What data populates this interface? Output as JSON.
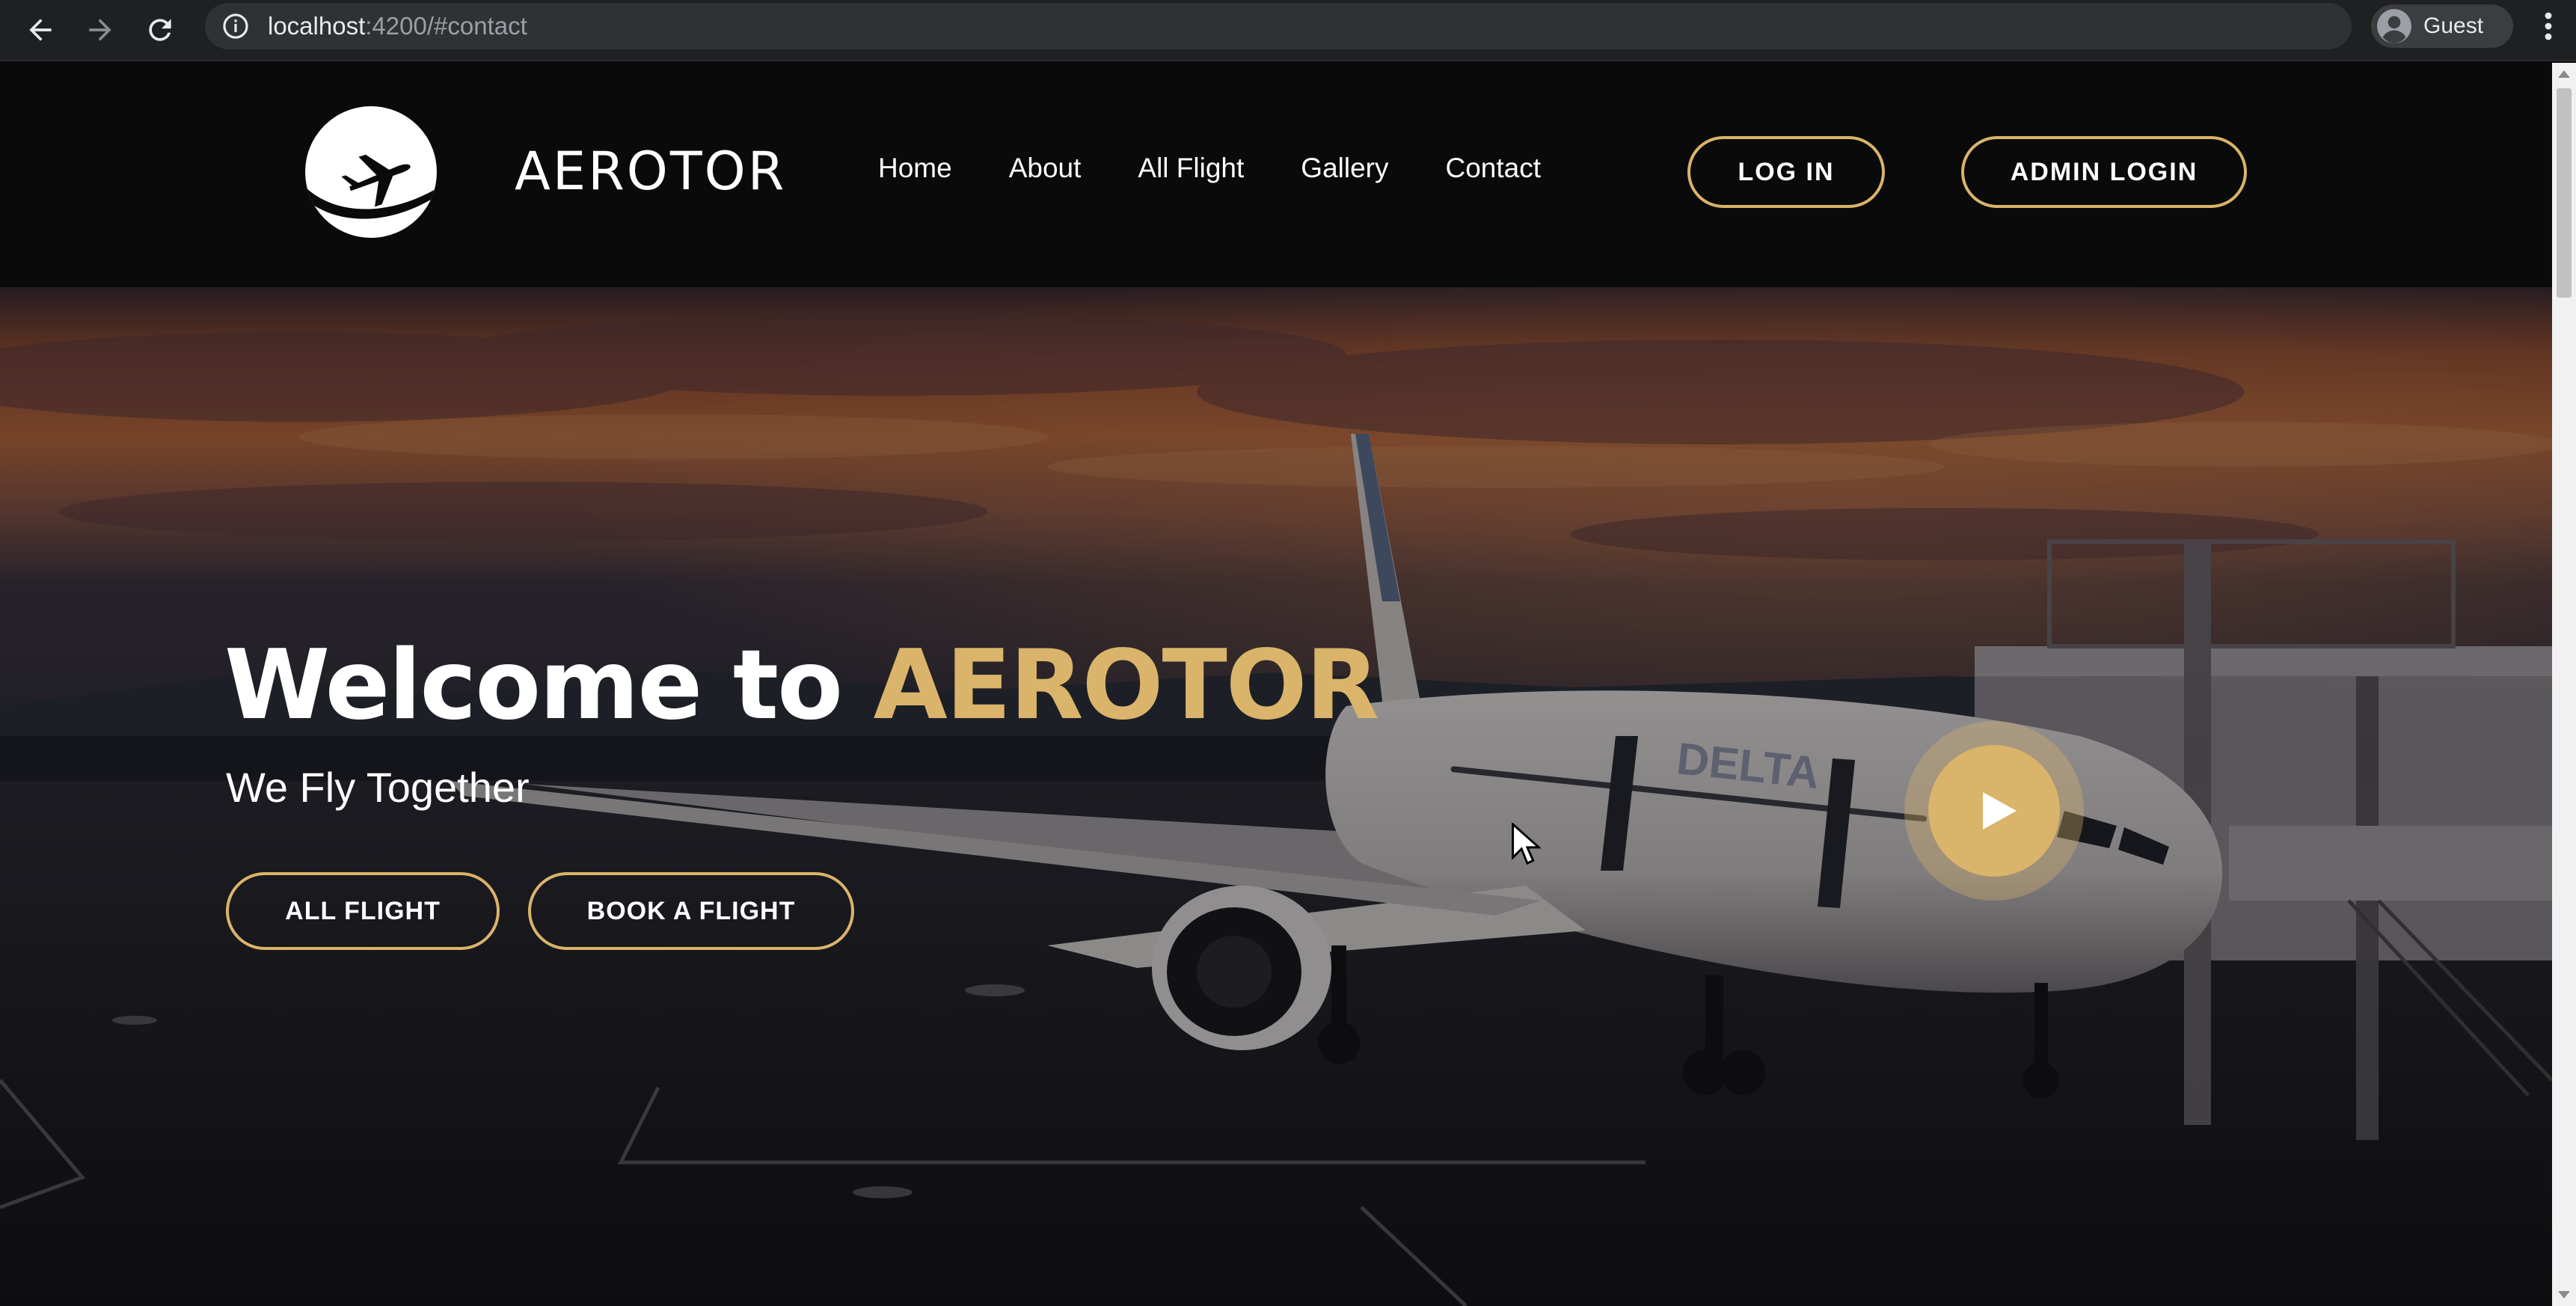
{
  "browser": {
    "url_host": "localhost",
    "url_path": ":4200/#contact",
    "profile_label": "Guest"
  },
  "header": {
    "brand": "AEROTOR",
    "nav": [
      "Home",
      "About",
      "All Flight",
      "Gallery",
      "Contact"
    ],
    "login_label": "LOG IN",
    "admin_login_label": "ADMIN LOGIN"
  },
  "hero": {
    "title_prefix": "Welcome to ",
    "title_accent": "AEROTOR",
    "subtitle": "We Fly Together",
    "all_flight_label": "ALL FLIGHT",
    "book_flight_label": "BOOK A FLIGHT",
    "airline_livery": "DELTA"
  },
  "colors": {
    "accent": "#d9b46a",
    "header_bg": "#0a0a0b",
    "browser_bg": "#1f2022"
  },
  "icons": {
    "back": "arrow-left-icon",
    "forward": "arrow-right-icon",
    "reload": "reload-icon",
    "info": "info-icon",
    "profile": "user-circle-icon",
    "menu": "kebab-menu-icon",
    "logo": "airplane-icon",
    "play": "play-icon"
  }
}
